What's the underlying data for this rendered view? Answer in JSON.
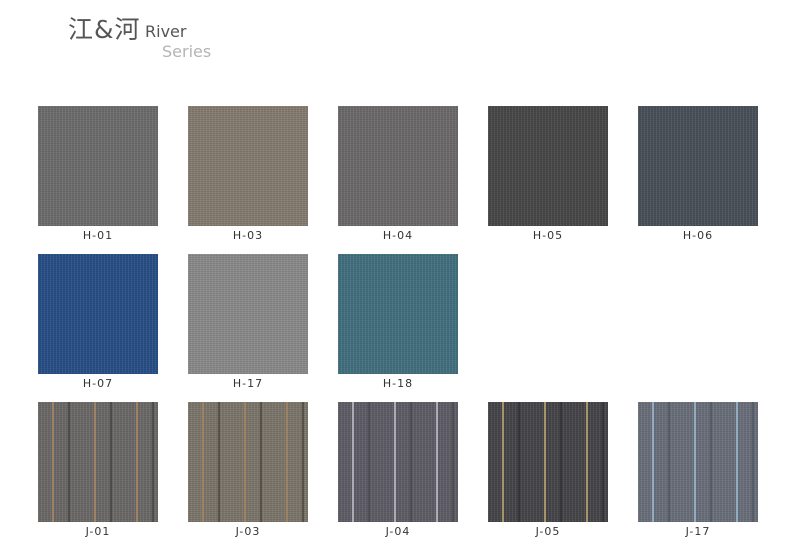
{
  "header": {
    "title_cn": "江&河",
    "title_en": "River",
    "subtitle": "Series"
  },
  "swatches": [
    {
      "code": "H-01",
      "color": "#6d6d6d"
    },
    {
      "code": "H-03",
      "color": "#857c70"
    },
    {
      "code": "H-04",
      "color": "#6d6a6c"
    },
    {
      "code": "H-05",
      "color": "#484848"
    },
    {
      "code": "H-06",
      "color": "#4a5059"
    },
    {
      "code": "H-07",
      "color": "#284f86"
    },
    {
      "code": "H-17",
      "color": "#8a8a8a"
    },
    {
      "code": "H-18",
      "color": "#42707e"
    },
    {
      "code": "J-01",
      "color": "#6c6a68",
      "stripe_colors": [
        "#b08a64",
        "#3a3838"
      ]
    },
    {
      "code": "J-03",
      "color": "#7c766c",
      "stripe_colors": [
        "#a8865e",
        "#3e3a34"
      ]
    },
    {
      "code": "J-04",
      "color": "#5f5d66",
      "stripe_colors": [
        "#c6c6d0",
        "#43414a"
      ]
    },
    {
      "code": "J-05",
      "color": "#46464a",
      "stripe_colors": [
        "#c4ae72",
        "#29292b"
      ]
    },
    {
      "code": "J-17",
      "color": "#6a6f7a",
      "stripe_colors": [
        "#9ec0d8",
        "#4a505c"
      ]
    }
  ]
}
